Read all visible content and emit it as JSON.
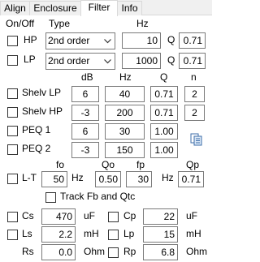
{
  "tabs": [
    "Align",
    "Enclosure",
    "Filter",
    "Info"
  ],
  "active_tab": "Filter",
  "header": {
    "onoff": "On/Off",
    "type": "Type",
    "hz": "Hz"
  },
  "hp": {
    "label": "HP",
    "type": "2nd order",
    "hz": "10",
    "q_label": "Q",
    "q": "0.71"
  },
  "lp": {
    "label": "LP",
    "type": "2nd order",
    "hz": "1000",
    "q_label": "Q",
    "q": "0.71"
  },
  "peq_header": {
    "db": "dB",
    "hz": "Hz",
    "q": "Q",
    "n": "n"
  },
  "shelv_lp": {
    "label": "Shelv LP",
    "db": "6",
    "hz": "40",
    "q": "0.71",
    "n": "2"
  },
  "shelv_hp": {
    "label": "Shelv HP",
    "db": "-3",
    "hz": "200",
    "q": "0.71",
    "n": "2"
  },
  "peq1": {
    "label": "PEQ 1",
    "db": "6",
    "hz": "30",
    "q": "1.00"
  },
  "peq2": {
    "label": "PEQ 2",
    "db": "-3",
    "hz": "150",
    "q": "1.00"
  },
  "copy_icon": "copy-icon",
  "lt_header": {
    "fo": "fo",
    "qo": "Qo",
    "fp": "fp",
    "qp": "Qp"
  },
  "lt": {
    "label": "L-T",
    "fo": "50",
    "hz1": "Hz",
    "qo": "0.50",
    "fp": "30",
    "hz2": "Hz",
    "qp": "0.71"
  },
  "track_label": "Track Fb and Qtc",
  "cs": {
    "label": "Cs",
    "value": "470",
    "unit": "uF"
  },
  "cp": {
    "label": "Cp",
    "value": "22",
    "unit": "uF"
  },
  "ls": {
    "label": "Ls",
    "value": "2.2",
    "unit": "mH"
  },
  "lp_ind": {
    "label": "Lp",
    "value": "15",
    "unit": "mH"
  },
  "rs": {
    "label": "Rs",
    "value": "0.0",
    "unit": "Ohm"
  },
  "rp": {
    "label": "Rp",
    "value": "6.8",
    "unit": "Ohm"
  }
}
